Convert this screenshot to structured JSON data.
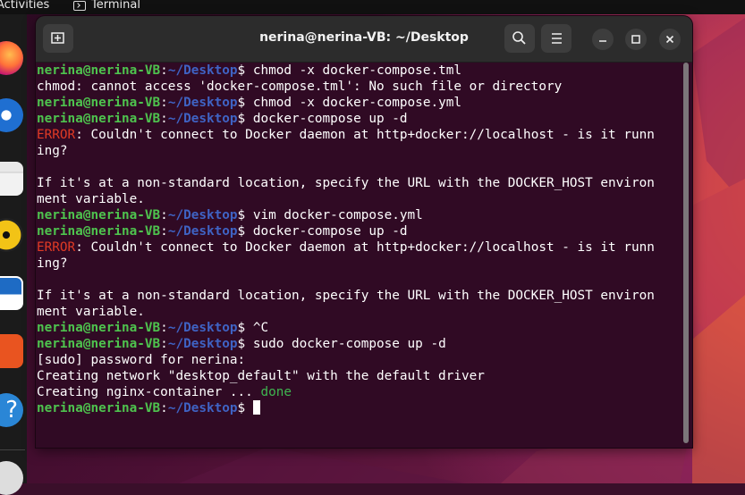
{
  "topbar": {
    "activities": "Activities",
    "app_name": "Terminal"
  },
  "dock": {
    "items": [
      "firefox-icon",
      "thunderbird-icon",
      "files-icon",
      "rhythmbox-icon",
      "libreoffice-writer-icon",
      "software-icon",
      "help-icon",
      "updater-icon"
    ]
  },
  "window": {
    "title": "nerina@nerina-VB: ~/Desktop",
    "buttons": [
      "new-tab",
      "search",
      "menu",
      "minimize",
      "maximize",
      "close"
    ]
  },
  "prompt": {
    "user": "nerina@nerina-VB",
    "path": "~/Desktop"
  },
  "terminal": {
    "lines": [
      {
        "type": "cmd",
        "user": "nerina@nerina-VB",
        "path": "~/Desktop",
        "text": "chmod -x docker-compose.tml"
      },
      {
        "type": "out",
        "text": "chmod: cannot access 'docker-compose.tml': No such file or directory"
      },
      {
        "type": "cmd",
        "user": "nerina@nerina-VB",
        "path": "~/Desktop",
        "text": "chmod -x docker-compose.yml"
      },
      {
        "type": "cmd",
        "user": "nerina@nerina-VB",
        "path": "~/Desktop",
        "text": "docker-compose up -d"
      },
      {
        "type": "err",
        "label": "ERROR",
        "text": ": Couldn't connect to Docker daemon at http+docker://localhost - is it runn"
      },
      {
        "type": "out",
        "text": "ing?"
      },
      {
        "type": "out",
        "text": ""
      },
      {
        "type": "out",
        "text": "If it's at a non-standard location, specify the URL with the DOCKER_HOST environ"
      },
      {
        "type": "out",
        "text": "ment variable."
      },
      {
        "type": "cmd",
        "user": "nerina@nerina-VB",
        "path": "~/Desktop",
        "text": "vim docker-compose.yml"
      },
      {
        "type": "cmd",
        "user": "nerina@nerina-VB",
        "path": "~/Desktop",
        "text": "docker-compose up -d"
      },
      {
        "type": "err",
        "label": "ERROR",
        "text": ": Couldn't connect to Docker daemon at http+docker://localhost - is it runn"
      },
      {
        "type": "out",
        "text": "ing?"
      },
      {
        "type": "out",
        "text": ""
      },
      {
        "type": "out",
        "text": "If it's at a non-standard location, specify the URL with the DOCKER_HOST environ"
      },
      {
        "type": "out",
        "text": "ment variable."
      },
      {
        "type": "cmd",
        "user": "nerina@nerina-VB",
        "path": "~/Desktop",
        "text": "^C"
      },
      {
        "type": "cmd",
        "user": "nerina@nerina-VB",
        "path": "~/Desktop",
        "text": "sudo docker-compose up -d"
      },
      {
        "type": "out",
        "text": "[sudo] password for nerina:"
      },
      {
        "type": "out",
        "text": "Creating network \"desktop_default\" with the default driver"
      },
      {
        "type": "status",
        "text": "Creating nginx-container ... ",
        "status": "done"
      },
      {
        "type": "prompt",
        "user": "nerina@nerina-VB",
        "path": "~/Desktop",
        "text": ""
      }
    ]
  },
  "colors": {
    "terminal_bg": "#300a24",
    "user": "#4ec34e",
    "path": "#3f63c4",
    "error": "#e03a24",
    "done": "#3fb550"
  }
}
